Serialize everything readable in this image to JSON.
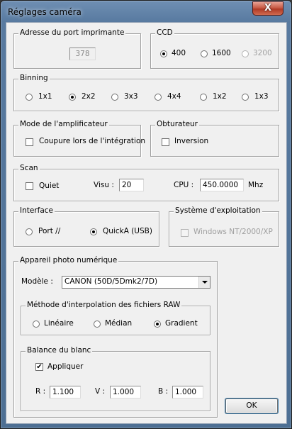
{
  "window": {
    "title": "Réglages caméra",
    "close_label": "X"
  },
  "port": {
    "legend": "Adresse du port imprimante",
    "value": "378"
  },
  "ccd": {
    "legend": "CCD",
    "options": [
      "400",
      "1600",
      "3200"
    ],
    "selected": "400"
  },
  "binning": {
    "legend": "Binning",
    "options": [
      "1x1",
      "2x2",
      "3x3",
      "4x4",
      "1x2",
      "1x3"
    ],
    "selected": "2x2"
  },
  "amplifier": {
    "legend": "Mode de l'amplificateur",
    "checkbox_label": "Coupure lors de l'intégration",
    "checked": false
  },
  "shutter": {
    "legend": "Obturateur",
    "checkbox_label": "Inversion",
    "checked": false
  },
  "scan": {
    "legend": "Scan",
    "quiet_label": "Quiet",
    "quiet_checked": false,
    "visu_label": "Visu :",
    "visu_value": "20",
    "cpu_label": "CPU :",
    "cpu_value": "450.0000",
    "cpu_unit": "Mhz"
  },
  "interface": {
    "legend": "Interface",
    "options": [
      "Port //",
      "QuickA (USB)"
    ],
    "selected": "QuickA (USB)"
  },
  "os": {
    "legend": "Système d'exploitation",
    "checkbox_label": "Windows NT/2000/XP",
    "checked": false
  },
  "camera": {
    "legend": "Appareil photo numérique",
    "model_label": "Modèle :",
    "model_value": "CANON (50D/5Dmk2/7D)",
    "interp": {
      "legend": "Méthode d'interpolation des fichiers RAW",
      "options": [
        "Linéaire",
        "Médian",
        "Gradient"
      ],
      "selected": "Gradient"
    },
    "wb": {
      "legend": "Balance du blanc",
      "apply_label": "Appliquer",
      "apply_checked": true,
      "r_label": "R :",
      "r_value": "1.100",
      "g_label": "V :",
      "g_value": "1.000",
      "b_label": "B :",
      "b_value": "1.000"
    }
  },
  "ok_label": "OK",
  "icons": {
    "check": "✔"
  }
}
